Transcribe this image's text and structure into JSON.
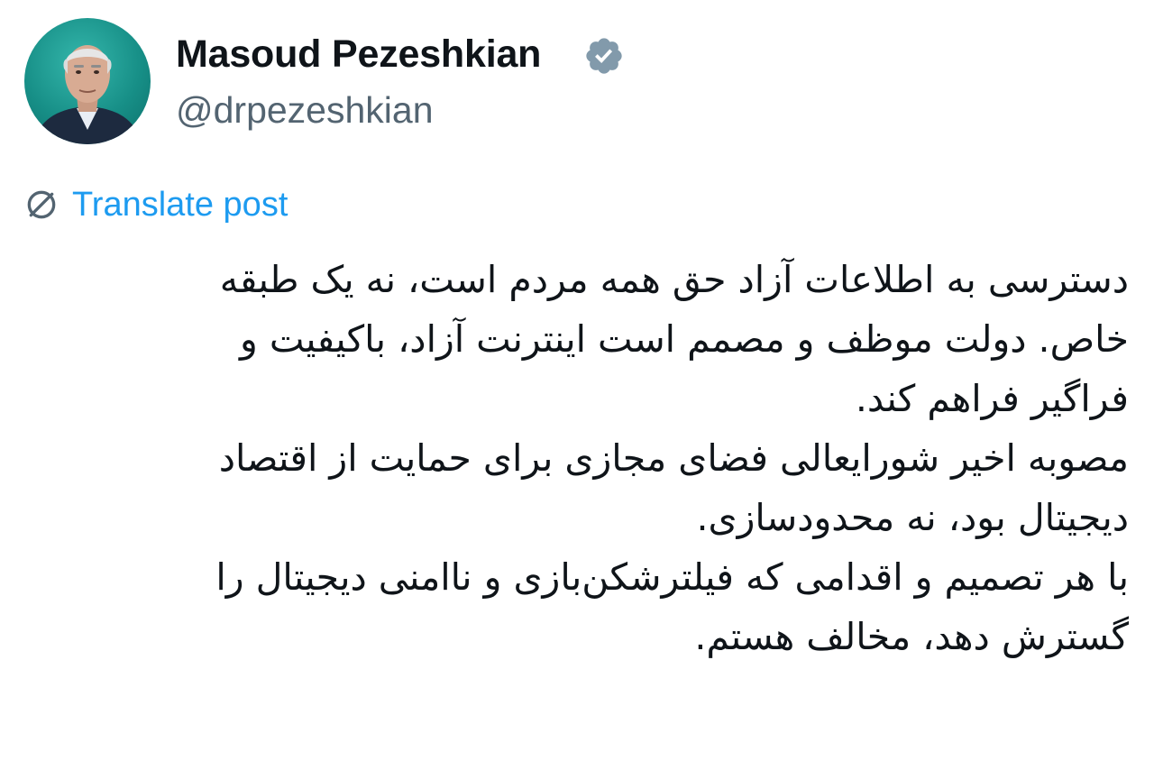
{
  "author": {
    "display_name": "Masoud Pezeshkian",
    "handle": "@drpezeshkian",
    "avatar_icon": "profile-photo",
    "verified_icon": "verified-badge-icon",
    "verified_color": "#829aab"
  },
  "translate": {
    "icon": "translate-globe-icon",
    "label": "Translate post",
    "color": "#1d9bf0"
  },
  "post": {
    "lines": [
      "دسترسی به اطلاعات آزاد حق همه مردم است، نه یک طبقه",
      "خاص. دولت موظف و مصمم است اینترنت آزاد، باکیفیت و",
      "فراگیر فراهم کند.",
      "مصوبه اخیر شورایعالی فضای مجازی برای حمایت از اقتصاد",
      "دیجیتال بود، نه محدودسازی.",
      "با هر تصمیم و اقدامی که فیلترشکن‌بازی و ناامنی دیجیتال را",
      "گسترش دهد، مخالف هستم."
    ]
  }
}
